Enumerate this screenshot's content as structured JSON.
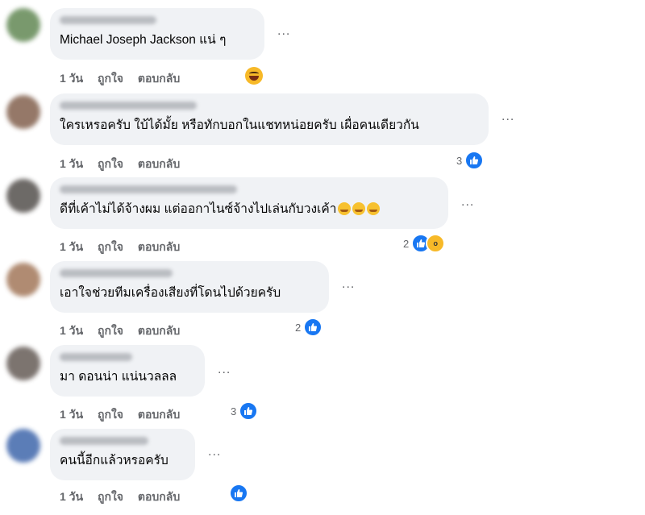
{
  "comments": [
    {
      "avatar_color": "#6b8f5e",
      "text": "Michael Joseph Jackson แน่ ๆ",
      "age": "1 วัน",
      "like_label": "ถูกใจ",
      "reply_label": "ตอบกลับ",
      "reaction": "laugh-emoji",
      "count": ""
    },
    {
      "avatar_color": "#8a6a58",
      "text": "ใครเหรอครับ ใบ้ได้มั้ย หรือทักบอกในแชทหน่อยครับ เผื่อคนเดียวกัน",
      "age": "1 วัน",
      "like_label": "ถูกใจ",
      "reply_label": "ตอบกลับ",
      "reaction": "like",
      "count": "3"
    },
    {
      "avatar_color": "#5e5a57",
      "text": "ดีที่เค้าไม่ได้จ้างผม แต่ออกาไนซ์จ้างไปเล่นกับวงเค้า",
      "age": "1 วัน",
      "like_label": "ถูกใจ",
      "reply_label": "ตอบกลับ",
      "reaction": "like+wow",
      "count": "2"
    },
    {
      "avatar_color": "#a87f63",
      "text": "เอาใจช่วยทีมเครื่องเสียงที่โดนไปด้วยครับ",
      "age": "1 วัน",
      "like_label": "ถูกใจ",
      "reply_label": "ตอบกลับ",
      "reaction": "like",
      "count": "2"
    },
    {
      "avatar_color": "#6e6560",
      "text": "มา ดอนน่า แน่นวลลล",
      "age": "1 วัน",
      "like_label": "ถูกใจ",
      "reply_label": "ตอบกลับ",
      "reaction": "like",
      "count": "3"
    },
    {
      "avatar_color": "#4a6fb0",
      "text": "คนนี้อีกแล้วหรอครับ",
      "age": "1 วัน",
      "like_label": "ถูกใจ",
      "reply_label": "ตอบกลับ",
      "reaction": "like",
      "count": ""
    }
  ],
  "more_label": "..."
}
